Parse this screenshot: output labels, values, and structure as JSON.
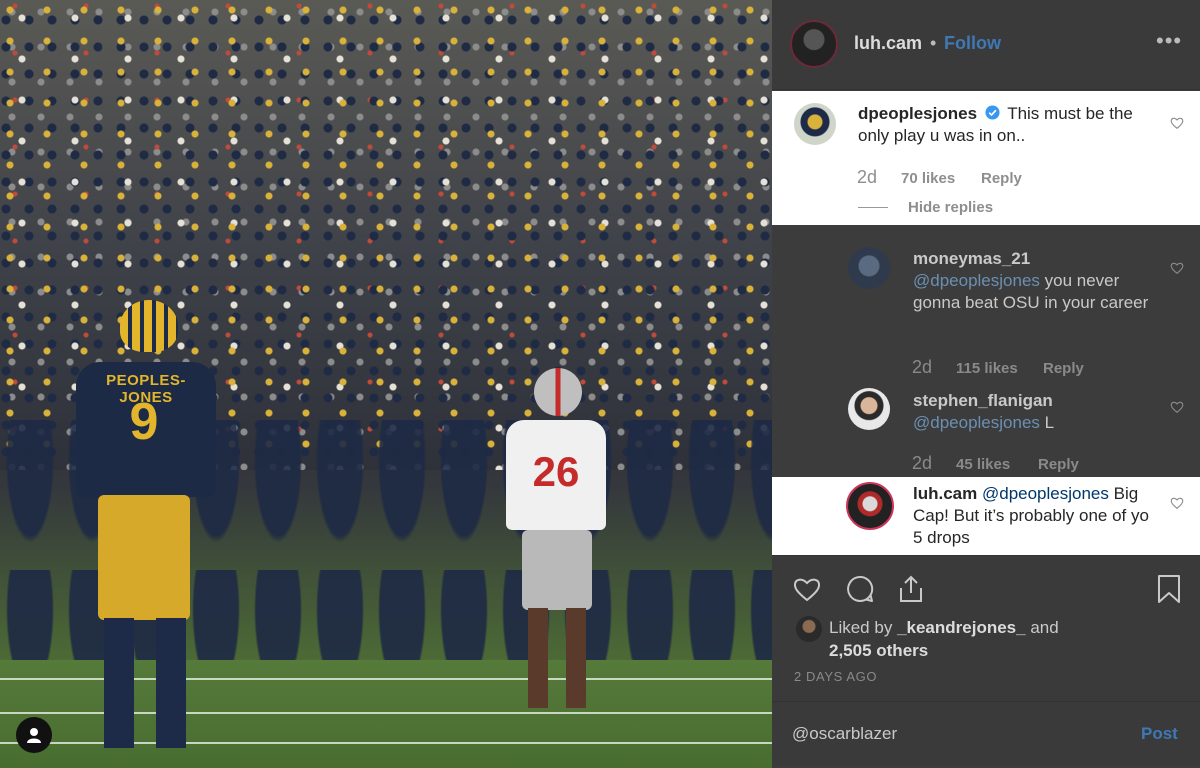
{
  "post": {
    "username": "luh.cam",
    "separator": "•",
    "follow_label": "Follow",
    "more_label": "•••"
  },
  "photo": {
    "player_left": {
      "name": "PEOPLES-JONES",
      "number": "9"
    },
    "player_right": {
      "number": "26"
    }
  },
  "comments": [
    {
      "user": "dpeoplesjones",
      "verified": true,
      "text": "This must be the only play u was in on..",
      "time": "2d",
      "likes": "70 likes",
      "reply_label": "Reply",
      "hide_replies": "Hide replies"
    },
    {
      "user": "moneymas_21",
      "mention": "@dpeoplesjones",
      "text": "you never gonna beat OSU in your career",
      "time": "2d",
      "likes": "115 likes",
      "reply_label": "Reply"
    },
    {
      "user": "stephen_flanigan",
      "mention": "@dpeoplesjones",
      "text": "L",
      "time": "2d",
      "likes": "45 likes",
      "reply_label": "Reply"
    },
    {
      "user": "luh.cam",
      "mention": "@dpeoplesjones",
      "text": "Big Cap! But it’s probably one of yo 5 drops"
    }
  ],
  "likes": {
    "liked_by_prefix": "Liked by",
    "liked_by_user": "_keandrejones_",
    "and": "and",
    "others": "2,505 others"
  },
  "date": "2 DAYS AGO",
  "add_comment": {
    "value": "@oscarblazer",
    "post_label": "Post"
  },
  "colors": {
    "accent": "#3f78b5",
    "verified": "#3897f0"
  }
}
